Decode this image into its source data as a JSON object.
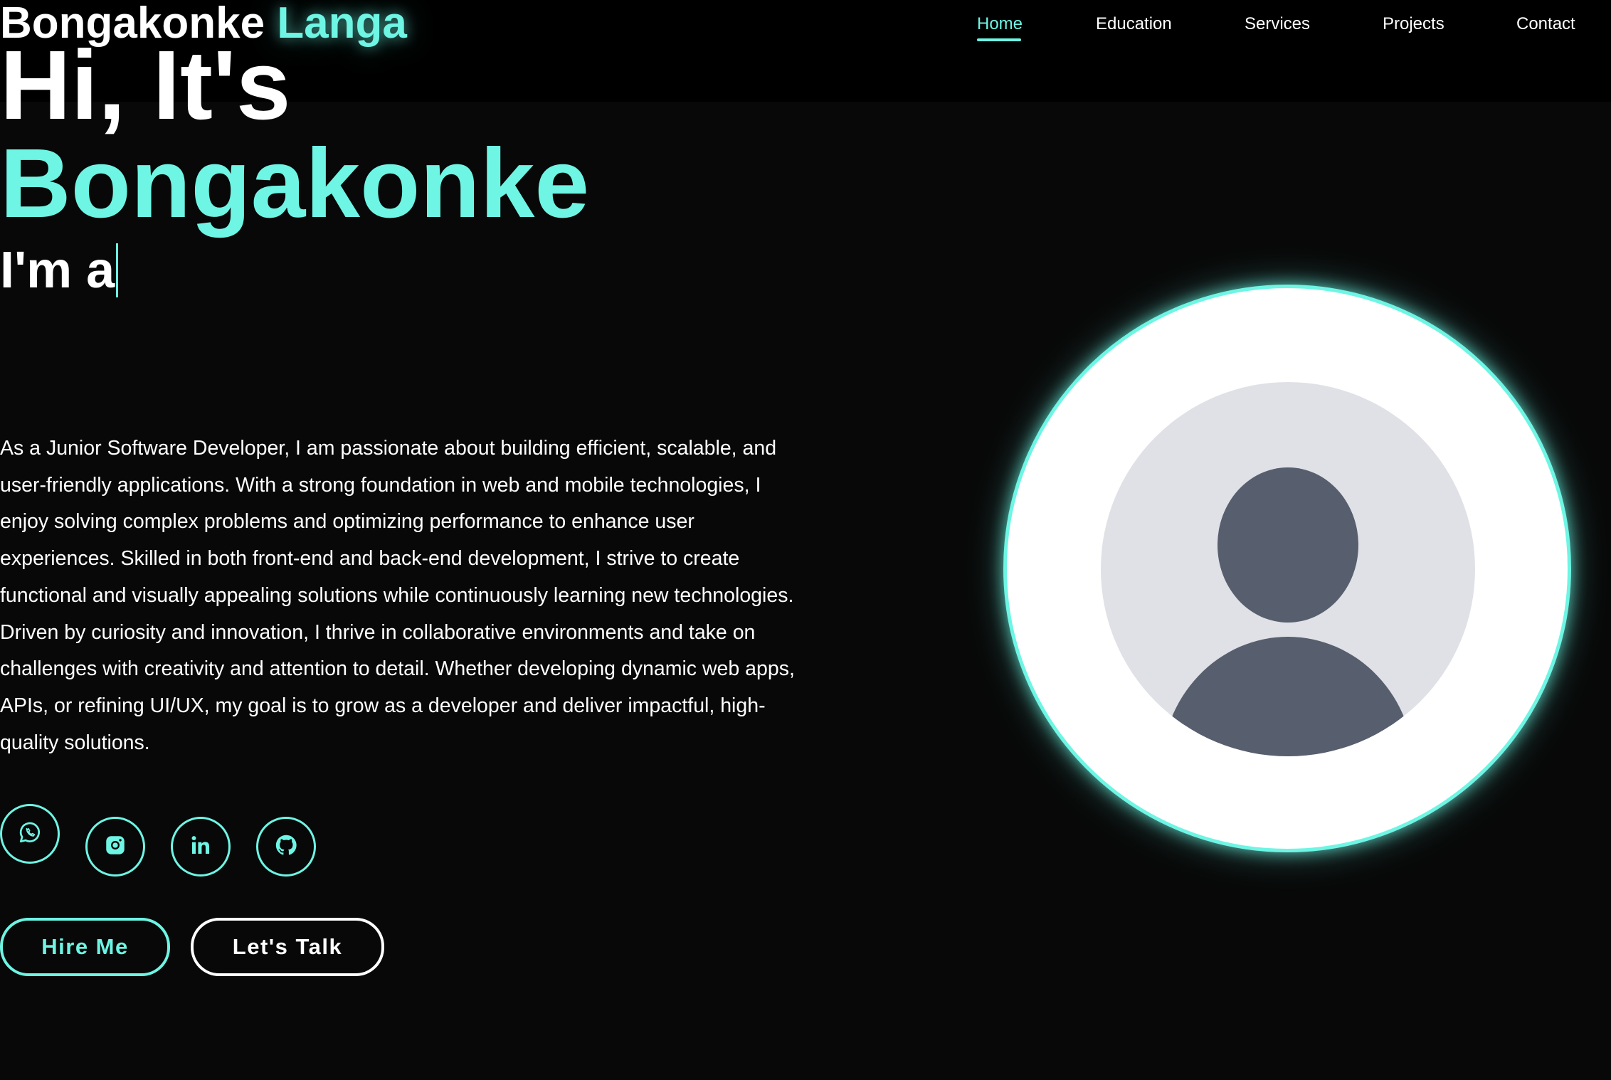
{
  "header": {
    "logo_first": "Bongakonke",
    "logo_second": "Langa",
    "nav": [
      {
        "label": "Home",
        "active": true
      },
      {
        "label": "Education",
        "active": false
      },
      {
        "label": "Services",
        "active": false
      },
      {
        "label": "Projects",
        "active": false
      },
      {
        "label": "Contact",
        "active": false
      }
    ]
  },
  "hero": {
    "greeting": "Hi, It's",
    "name": "Bongakonke",
    "role_prefix": "I'm a",
    "bio": "As a Junior Software Developer, I am passionate about building efficient, scalable, and user-friendly applications. With a strong foundation in web and mobile technologies, I enjoy solving complex problems and optimizing performance to enhance user experiences. Skilled in both front-end and back-end development, I strive to create functional and visually appealing solutions while continuously learning new technologies. Driven by curiosity and innovation, I thrive in collaborative environments and take on challenges with creativity and attention to detail. Whether developing dynamic web apps, APIs, or refining UI/UX, my goal is to grow as a developer and deliver impactful, high-quality solutions.",
    "social": [
      {
        "icon": "whatsapp-icon"
      },
      {
        "icon": "instagram-icon"
      },
      {
        "icon": "linkedin-icon"
      },
      {
        "icon": "github-icon"
      }
    ],
    "buttons": {
      "hire_label": "Hire Me",
      "talk_label": "Let's Talk"
    },
    "avatar_icon": "default-user-avatar-icon"
  },
  "colors": {
    "accent": "#6ef5e4",
    "background": "#080808",
    "header_bg": "#000000",
    "text": "#ffffff",
    "avatar_bg": "#e0e1e6",
    "avatar_figure": "#575e6d"
  }
}
